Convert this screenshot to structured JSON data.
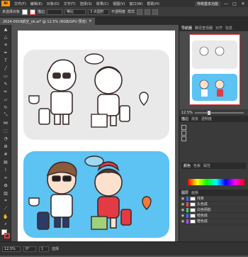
{
  "app": {
    "logo_text": "Ai",
    "menus": [
      "文件(F)",
      "编辑(E)",
      "对象(O)",
      "文字(T)",
      "选择(S)",
      "效果(C)",
      "视图(V)",
      "窗口(W)",
      "帮助(H)"
    ],
    "workspace": "传统基本功能",
    "win_controls": [
      "—",
      "□",
      "✕"
    ]
  },
  "control_bar": {
    "selection_label": "未选择对象",
    "stroke_label": "描边",
    "stroke_value": "",
    "profile_value": "等比",
    "brush_value": "3 点圆形",
    "opacity_label": "不透明度",
    "style_label": "样式",
    "doc_setup": "文档设置",
    "prefs": "首选项"
  },
  "document": {
    "tab_title": "2024-0918航空_ok.ai* @ 12.5% (RGB/GPU 预览)",
    "close": "✕"
  },
  "status": {
    "zoom": "12.5%",
    "angle": "0°",
    "page": "1",
    "tool": "选择"
  },
  "panels": {
    "top_tabs": [
      "导航器",
      "路径查找器",
      "对齐",
      "信息"
    ],
    "nav_zoom": "12.5%",
    "attr_tabs": [
      "描边",
      "渐变",
      "透明度"
    ],
    "color_tabs": [
      "颜色",
      "色板",
      "属性"
    ],
    "layer_tabs": [
      "图层",
      "画板"
    ],
    "layers": [
      {
        "name": "线条",
        "color": "#3b6bff"
      },
      {
        "name": "头色底",
        "color": "#ff4d4d"
      },
      {
        "name": "白色阴影",
        "color": "#3bd16f"
      },
      {
        "name": "暗色底",
        "color": "#3b6bff"
      },
      {
        "name": "橙色底",
        "color": "#b04dff"
      }
    ]
  },
  "colors": {
    "sky": "#5cc3f2",
    "card_gray": "#e9e9e9",
    "outline": "#3a2c2a",
    "attendant_red": "#e23b44",
    "pilot_navy": "#2b3a67"
  }
}
